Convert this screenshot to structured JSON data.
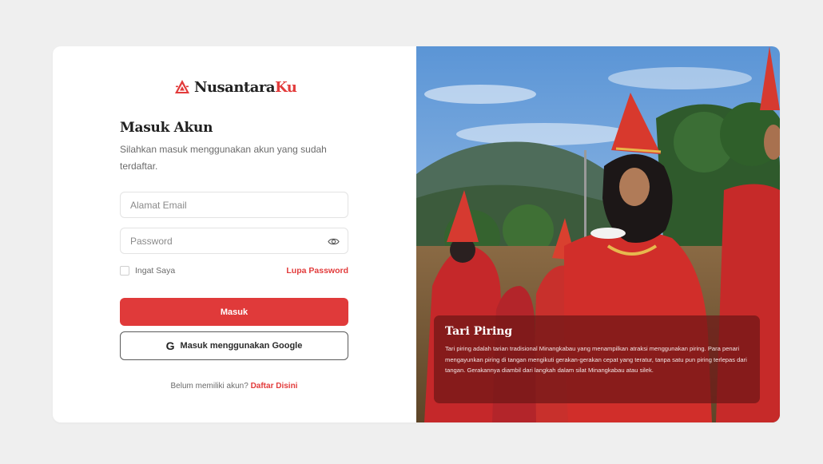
{
  "brand": {
    "name_primary": "Nusantara",
    "name_accent": "Ku",
    "accent_color": "#e23b3b",
    "logo_icon": "ornament-logo-icon"
  },
  "login": {
    "title": "Masuk Akun",
    "subtitle": "Silahkan masuk menggunakan akun yang sudah terdaftar.",
    "email_placeholder": "Alamat Email",
    "email_value": "",
    "password_placeholder": "Password",
    "password_value": "",
    "password_toggle_icon": "eye-icon",
    "remember_label": "Ingat Saya",
    "remember_checked": false,
    "forgot_label": "Lupa Password",
    "submit_label": "Masuk",
    "google_icon": "google-icon",
    "google_label": "Masuk menggunakan Google",
    "register_prompt": "Belum memiliki akun?",
    "register_link": "Daftar Disini"
  },
  "showcase": {
    "caption_title": "Tari Piring",
    "caption_text": "Tari piring adalah tarian tradisional Minangkabau yang menampilkan atraksi menggunakan piring. Para penari mengayunkan piring di tangan mengikuti gerakan-gerakan cepat yang teratur, tanpa satu pun piring terlepas dari tangan. Gerakannya diambil dari langkah dalam silat Minangkabau atau silek."
  },
  "colors": {
    "page_background": "#efefef",
    "primary_button": "#e03a3a",
    "caption_overlay": "#6e1616"
  }
}
